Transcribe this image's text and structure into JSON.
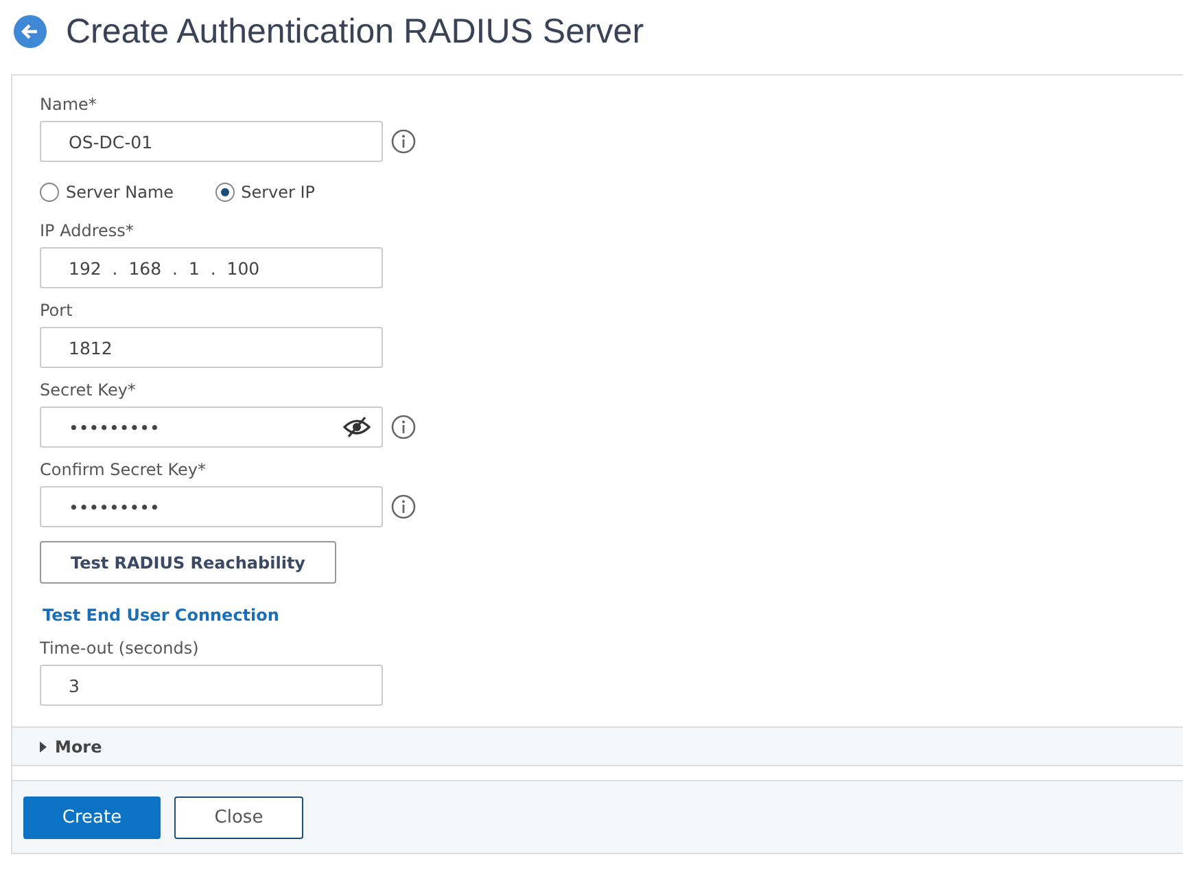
{
  "title": "Create Authentication RADIUS Server",
  "name_field": {
    "label": "Name*",
    "value": "OS-DC-01"
  },
  "server_type": [
    {
      "label": "Server Name",
      "selected": false
    },
    {
      "label": "Server IP",
      "selected": true
    }
  ],
  "ip_address": {
    "label": "IP Address*",
    "value": "192  .  168  .  1  .  100"
  },
  "port": {
    "label": "Port",
    "value": "1812"
  },
  "secret_key": {
    "label": "Secret Key*",
    "value": "•••••••••"
  },
  "confirm_secret_key": {
    "label": "Confirm Secret Key*",
    "value": "•••••••••"
  },
  "test_button": "Test RADIUS Reachability",
  "test_link": "Test End User Connection",
  "timeout": {
    "label": "Time-out (seconds)",
    "value": "3"
  },
  "more": {
    "label": "More",
    "expanded": false
  },
  "buttons": [
    {
      "label": "Create",
      "kind": "primary"
    },
    {
      "label": "Close",
      "kind": "secondary"
    }
  ]
}
